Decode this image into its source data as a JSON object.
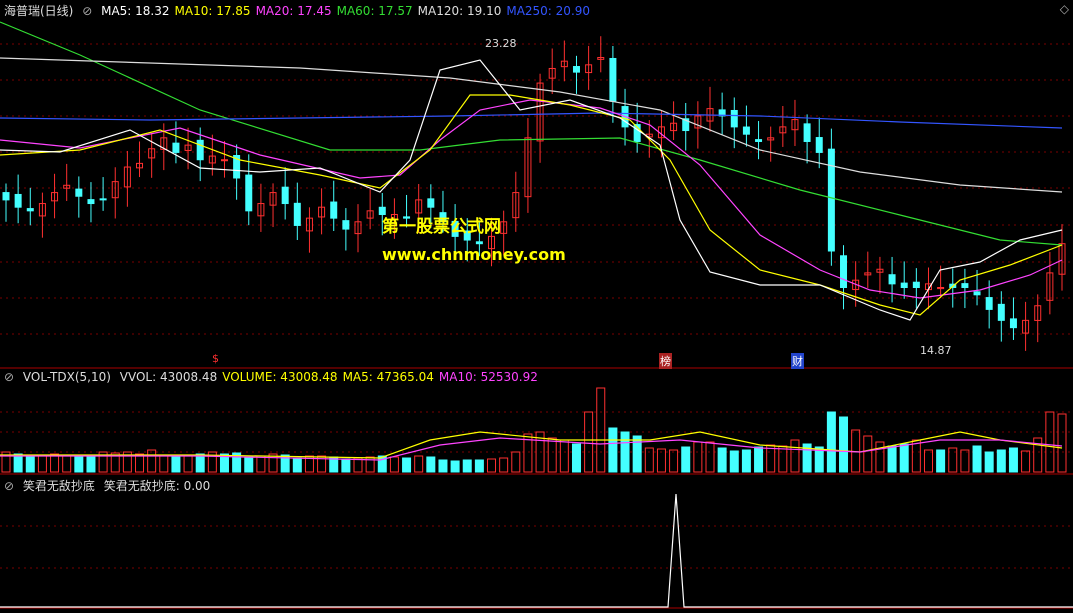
{
  "main_header": {
    "stock_name": "海普瑞(日线)",
    "items": [
      {
        "label": "MA5: 18.32",
        "color": "#ffffff"
      },
      {
        "label": "MA10: 17.85",
        "color": "#ffff00"
      },
      {
        "label": "MA20: 17.45",
        "color": "#ff44ff"
      },
      {
        "label": "MA60: 17.57",
        "color": "#33dd33"
      },
      {
        "label": "MA120: 19.10",
        "color": "#dddddd"
      },
      {
        "label": "MA250: 20.90",
        "color": "#3355ff"
      }
    ]
  },
  "watermark": {
    "line1": "第一股票公式网",
    "line2": "www.chnmoney.com"
  },
  "markers": {
    "high_label": "23.28",
    "low_label": "14.87",
    "event_s": "$",
    "event_bang": "榜",
    "event_cai": "财"
  },
  "vol_header": {
    "name": "VOL-TDX(5,10)",
    "items": [
      {
        "label": "VVOL: 43008.48",
        "color": "#dddddd"
      },
      {
        "label": "VOLUME: 43008.48",
        "color": "#ffff00"
      },
      {
        "label": "MA5: 47365.04",
        "color": "#ffff00"
      },
      {
        "label": "MA10: 52530.92",
        "color": "#ff44ff"
      }
    ]
  },
  "ind_header": {
    "name": "笑君无敌抄底",
    "value_label": "笑君无敌抄底: 0.00"
  },
  "colors": {
    "up": "#ff3030",
    "down": "#44ffff",
    "grid": "#7a0000",
    "border": "#aa0000"
  },
  "chart_data": {
    "type": "candlestick",
    "title": "海普瑞(日线)",
    "high": 23.28,
    "low": 14.87,
    "moving_averages": {
      "MA5": 18.32,
      "MA10": 17.85,
      "MA20": 17.45,
      "MA60": 17.57,
      "MA120": 19.1,
      "MA250": 20.9
    },
    "volume": {
      "VVOL": 43008.48,
      "VOLUME": 43008.48,
      "MA5": 47365.04,
      "MA10": 52530.92
    },
    "indicator": {
      "name": "笑君无敌抄底",
      "value": 0.0
    }
  }
}
